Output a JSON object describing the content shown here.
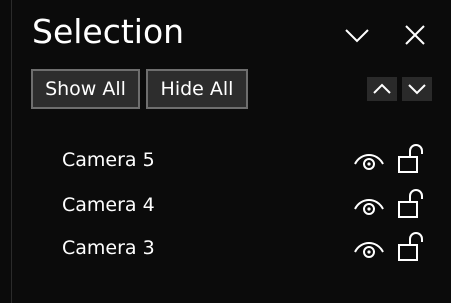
{
  "panel": {
    "title": "Selection",
    "icons": {
      "collapse": "chevron-down-icon",
      "close": "close-icon"
    }
  },
  "toolbar": {
    "show_all_label": "Show All",
    "hide_all_label": "Hide All",
    "move_up_icon": "chevron-up-icon",
    "move_down_icon": "chevron-down-icon"
  },
  "items": [
    {
      "label": "Camera 5",
      "visible": true,
      "locked": false
    },
    {
      "label": "Camera 4",
      "visible": true,
      "locked": false
    },
    {
      "label": "Camera 3",
      "visible": true,
      "locked": false
    }
  ],
  "colors": {
    "background": "#0b0b0b",
    "text": "#ffffff",
    "button_bg": "#2d2d2d",
    "button_border": "#6e6e6e"
  }
}
